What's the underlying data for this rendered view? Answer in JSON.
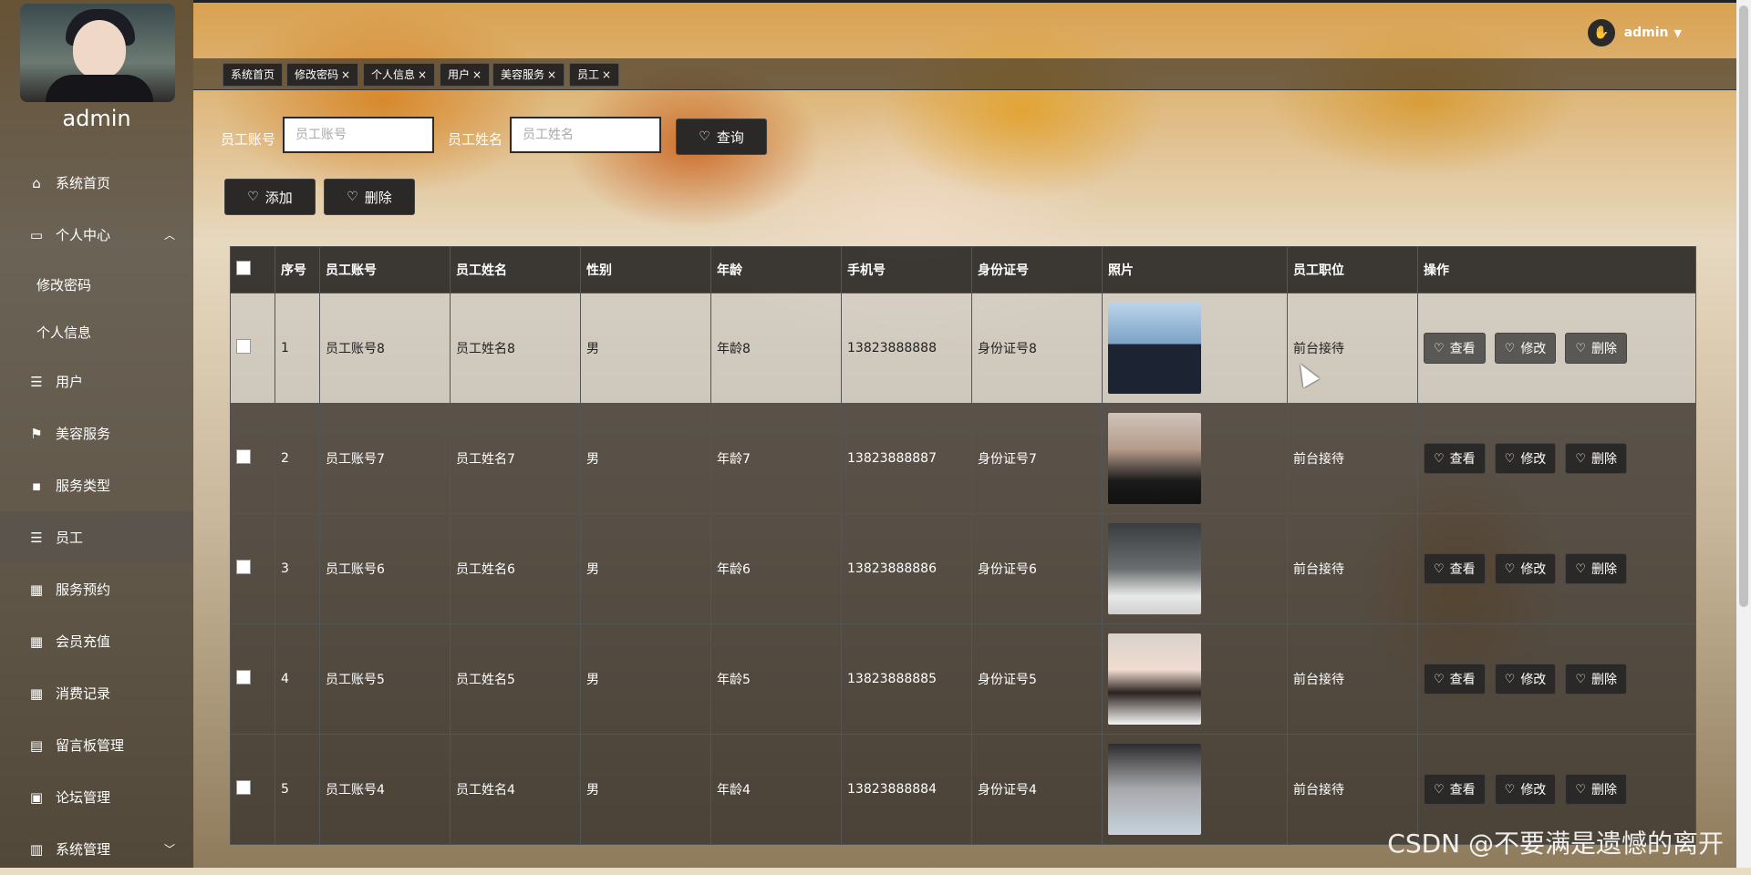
{
  "sidebar": {
    "username": "admin",
    "items": [
      {
        "label": "系统首页",
        "icon": "home-icon"
      },
      {
        "label": "个人中心",
        "icon": "user-card-icon"
      },
      {
        "label": "修改密码",
        "icon": ""
      },
      {
        "label": "个人信息",
        "icon": ""
      },
      {
        "label": "用户",
        "icon": "list-icon"
      },
      {
        "label": "美容服务",
        "icon": "flag-icon"
      },
      {
        "label": "服务类型",
        "icon": "chat-icon"
      },
      {
        "label": "员工",
        "icon": "list-icon"
      },
      {
        "label": "服务预约",
        "icon": "grid-icon"
      },
      {
        "label": "会员充值",
        "icon": "grid-icon"
      },
      {
        "label": "消费记录",
        "icon": "grid-icon"
      },
      {
        "label": "留言板管理",
        "icon": "print-icon"
      },
      {
        "label": "论坛管理",
        "icon": "briefcase-icon"
      },
      {
        "label": "系统管理",
        "icon": "clipboard-icon"
      }
    ]
  },
  "topbar": {
    "username": "admin"
  },
  "tabs": [
    "系统首页",
    "修改密码",
    "个人信息",
    "用户",
    "美容服务",
    "员工"
  ],
  "search": {
    "account_label": "员工账号",
    "account_placeholder": "员工账号",
    "name_label": "员工姓名",
    "name_placeholder": "员工姓名",
    "query_button": "查询"
  },
  "actions": {
    "add": "添加",
    "delete": "删除"
  },
  "table": {
    "headers": [
      "序号",
      "员工账号",
      "员工姓名",
      "性别",
      "年龄",
      "手机号",
      "身份证号",
      "照片",
      "员工职位",
      "操作"
    ],
    "ops": {
      "view": "查看",
      "edit": "修改",
      "delete": "删除"
    },
    "rows": [
      {
        "index": "1",
        "account": "员工账号8",
        "name": "员工姓名8",
        "gender": "男",
        "age": "年龄8",
        "phone": "13823888888",
        "id_card": "身份证号8",
        "position": "前台接待"
      },
      {
        "index": "2",
        "account": "员工账号7",
        "name": "员工姓名7",
        "gender": "男",
        "age": "年龄7",
        "phone": "13823888887",
        "id_card": "身份证号7",
        "position": "前台接待"
      },
      {
        "index": "3",
        "account": "员工账号6",
        "name": "员工姓名6",
        "gender": "男",
        "age": "年龄6",
        "phone": "13823888886",
        "id_card": "身份证号6",
        "position": "前台接待"
      },
      {
        "index": "4",
        "account": "员工账号5",
        "name": "员工姓名5",
        "gender": "男",
        "age": "年龄5",
        "phone": "13823888885",
        "id_card": "身份证号5",
        "position": "前台接待"
      },
      {
        "index": "5",
        "account": "员工账号4",
        "name": "员工姓名4",
        "gender": "男",
        "age": "年龄4",
        "phone": "13823888884",
        "id_card": "身份证号4",
        "position": "前台接待"
      }
    ]
  },
  "watermark": "CSDN @不要满是遗憾的离开"
}
